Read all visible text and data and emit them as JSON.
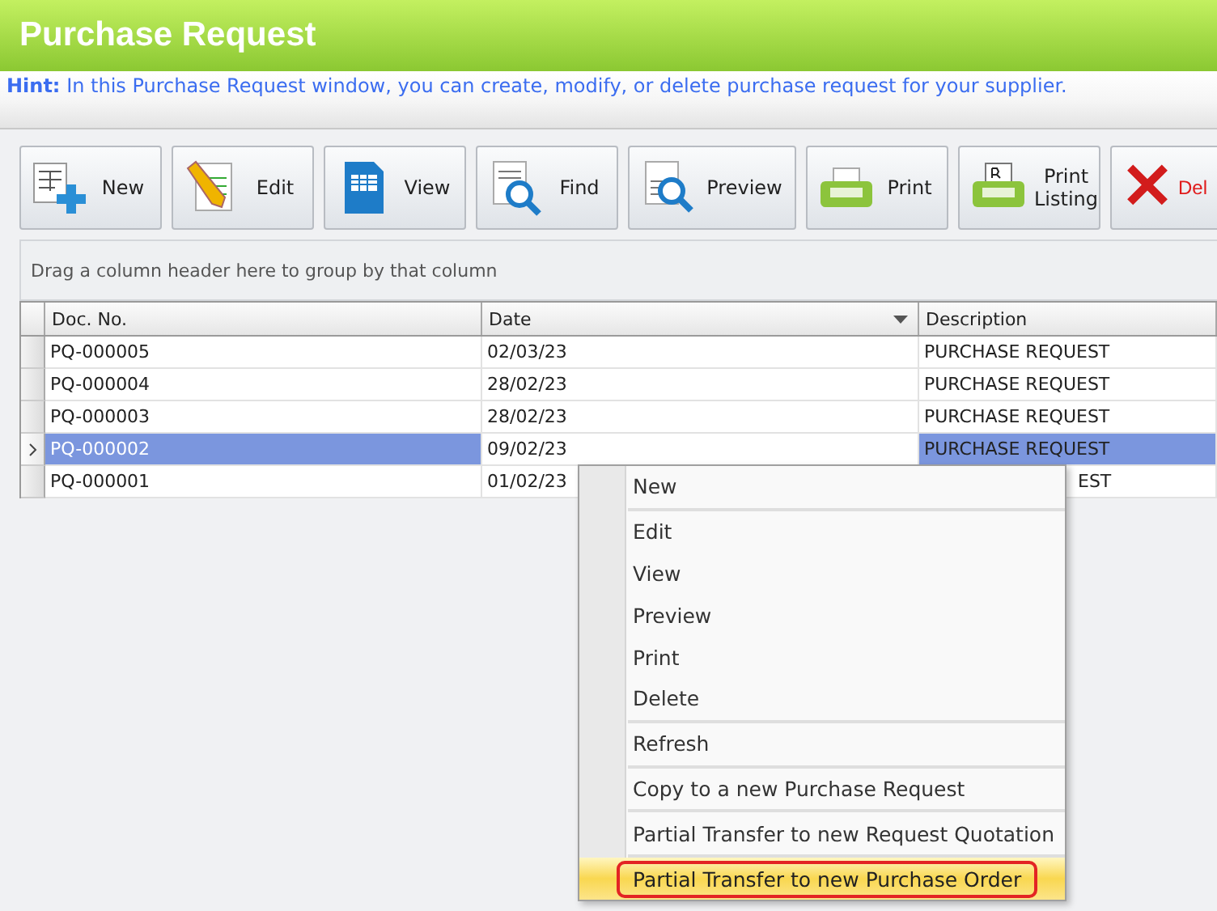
{
  "window": {
    "title": "Purchase Request"
  },
  "hint": {
    "label": "Hint:",
    "text": "In this Purchase Request window, you can create, modify, or delete purchase request for your supplier."
  },
  "toolbar": [
    {
      "kind": "new",
      "label": "New"
    },
    {
      "kind": "edit",
      "label": "Edit"
    },
    {
      "kind": "view",
      "label": "View"
    },
    {
      "kind": "find",
      "label": "Find"
    },
    {
      "kind": "preview",
      "label": "Preview"
    },
    {
      "kind": "print",
      "label": "Print"
    },
    {
      "kind": "listing",
      "label": "Print Listing"
    },
    {
      "kind": "delete",
      "label": "Del"
    }
  ],
  "group_panel": {
    "text": "Drag a column header here to group by that column"
  },
  "table": {
    "columns": [
      {
        "label": "Doc. No.",
        "sorted": false
      },
      {
        "label": "Date",
        "sorted": true
      },
      {
        "label": "Description",
        "sorted": false
      }
    ],
    "rows": [
      {
        "doc_no": "PQ-000005",
        "date": "02/03/23",
        "description": "PURCHASE REQUEST",
        "covered": false,
        "selected": false
      },
      {
        "doc_no": "PQ-000004",
        "date": "28/02/23",
        "description": "PURCHASE REQUEST",
        "covered": false,
        "selected": false
      },
      {
        "doc_no": "PQ-000003",
        "date": "28/02/23",
        "description": "PURCHASE REQUEST",
        "covered": false,
        "selected": false
      },
      {
        "doc_no": "PQ-000002",
        "date": "09/02/23",
        "description": "PURCHASE REQUEST",
        "covered": false,
        "selected": true
      },
      {
        "doc_no": "PQ-000001",
        "date": "01/02/23",
        "description": "EST",
        "covered": true,
        "selected": false
      }
    ]
  },
  "context_menu": {
    "groups": [
      [
        {
          "label": "New",
          "selected": false
        }
      ],
      [
        {
          "label": "Edit",
          "selected": false
        },
        {
          "label": "View",
          "selected": false
        },
        {
          "label": "Preview",
          "selected": false
        },
        {
          "label": "Print",
          "selected": false
        },
        {
          "label": "Delete",
          "selected": false
        }
      ],
      [
        {
          "label": "Refresh",
          "selected": false
        }
      ],
      [
        {
          "label": "Copy to a new Purchase Request",
          "selected": false
        }
      ],
      [
        {
          "label": "Partial Transfer to new Request Quotation",
          "selected": false
        }
      ],
      [
        {
          "label": "Partial Transfer to new Purchase Order",
          "selected": true
        }
      ]
    ]
  }
}
